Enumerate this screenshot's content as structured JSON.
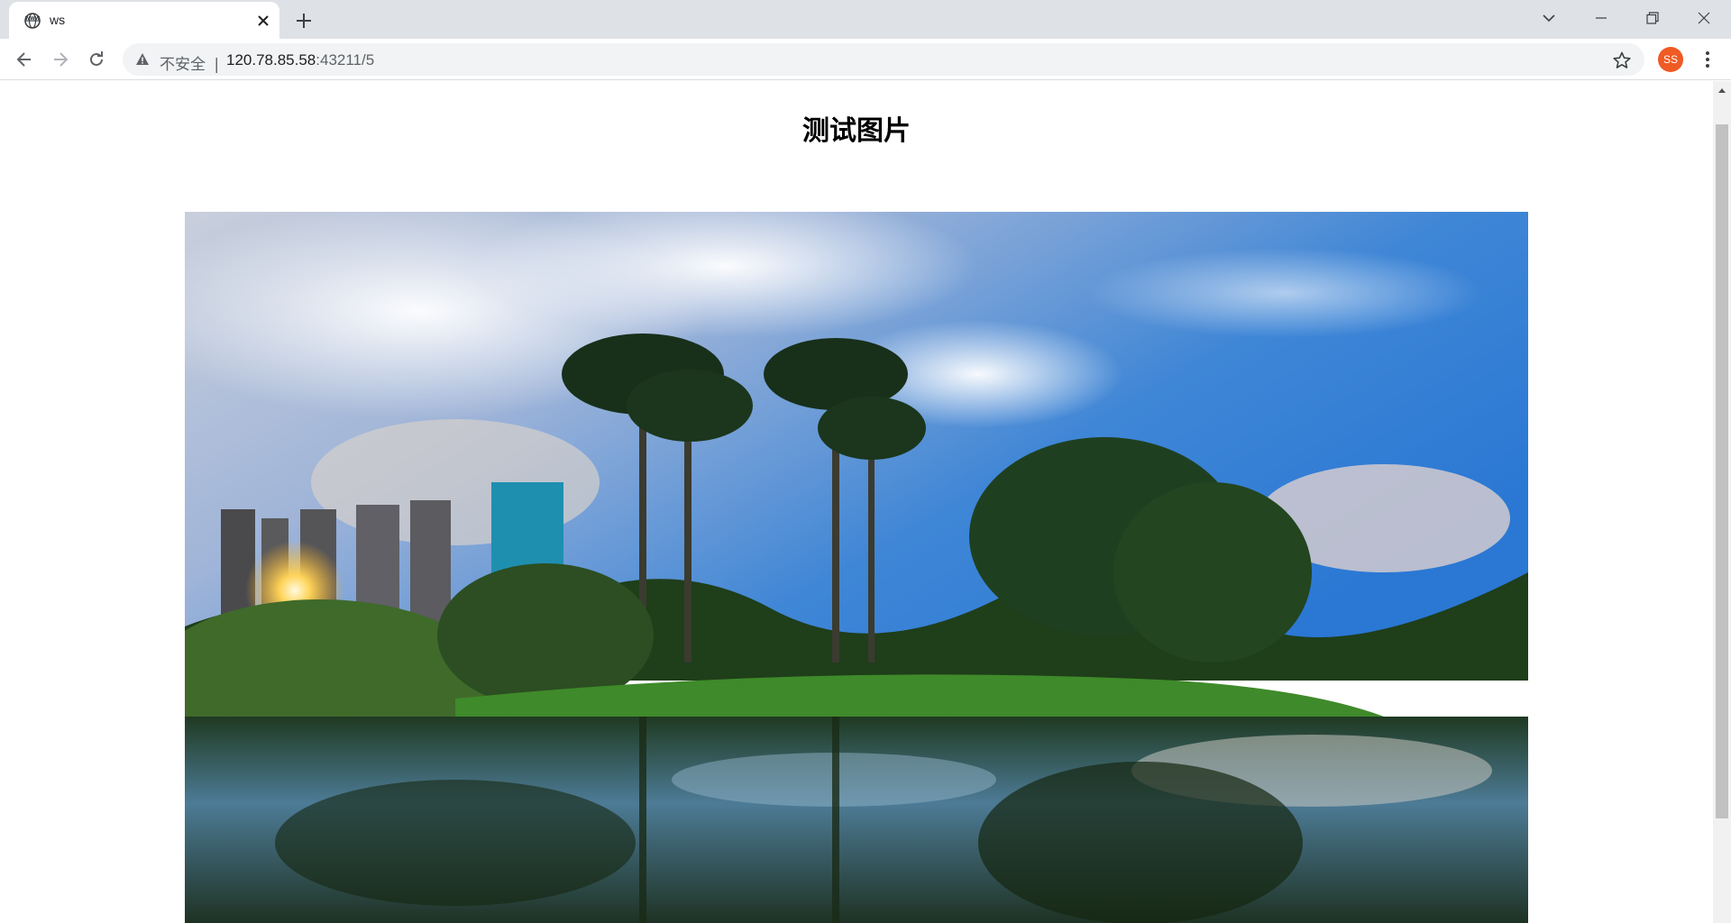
{
  "browser": {
    "tab": {
      "title": "ws",
      "favicon": "www-globe-icon"
    },
    "controls": [
      "back-icon",
      "forward-icon",
      "reload-icon"
    ],
    "address_bar": {
      "security_label": "不安全",
      "separator": "|",
      "url_host": "120.78.85.58",
      "url_rest": ":43211/5"
    },
    "profile_initials": "SS",
    "accent_color": "#f05a24"
  },
  "page": {
    "title": "测试图片",
    "image": {
      "description_icon": "landscape-photo",
      "subject": "palm-trees-lake-reflection"
    }
  }
}
